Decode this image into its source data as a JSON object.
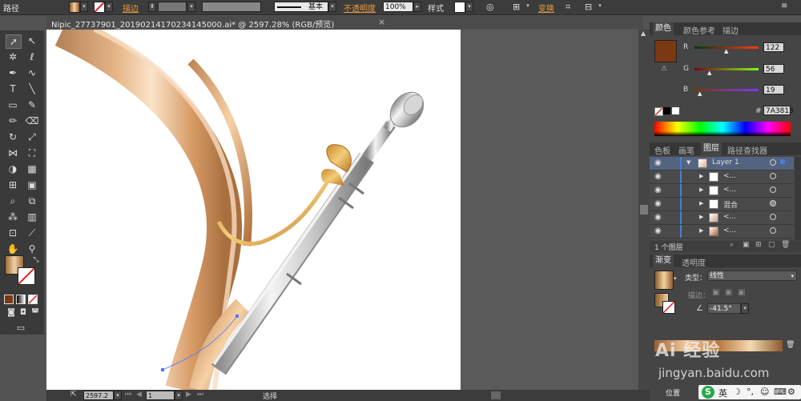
{
  "control_bar": {
    "path_label": "路径",
    "stroke_label": "描边",
    "stroke_style": "基本",
    "opacity_label": "不透明度",
    "opacity_value": "100%",
    "style_label": "样式",
    "transform_label": "变换"
  },
  "document": {
    "tab_title": "Nipic_27737901_20190214170234145000.ai* @ 2597.28% (RGB/预览)",
    "close_glyph": "×"
  },
  "status_bar": {
    "zoom_value": "2597.2",
    "page_value": "1",
    "mode_label": "选择"
  },
  "color_panel": {
    "tabs": [
      "颜色",
      "颜色参考",
      "描边"
    ],
    "r_label": "R",
    "r_value": "122",
    "g_label": "G",
    "g_value": "56",
    "b_label": "B",
    "b_value": "19",
    "hex_prefix": "#",
    "hex_value": "7A3813",
    "swatch_color": "#7A3813"
  },
  "layers_panel": {
    "tabs": [
      "色板",
      "画笔",
      "图层",
      "路径查找器"
    ],
    "rows": [
      {
        "name": "Layer 1"
      },
      {
        "name": "<..."
      },
      {
        "name": "<..."
      },
      {
        "name": "混合"
      },
      {
        "name": "<..."
      },
      {
        "name": "<..."
      }
    ],
    "footer_count": "1 个图层"
  },
  "gradient_panel": {
    "tabs": [
      "渐变",
      "透明度"
    ],
    "type_label": "类型：",
    "type_value": "线性",
    "stroke_label": "描边：",
    "angle_value": "-41.5°",
    "position_label": "位置"
  },
  "watermark": {
    "text": "Ai 经验",
    "url": "jingyan.baidu.com"
  },
  "ime": {
    "lang": "英"
  }
}
